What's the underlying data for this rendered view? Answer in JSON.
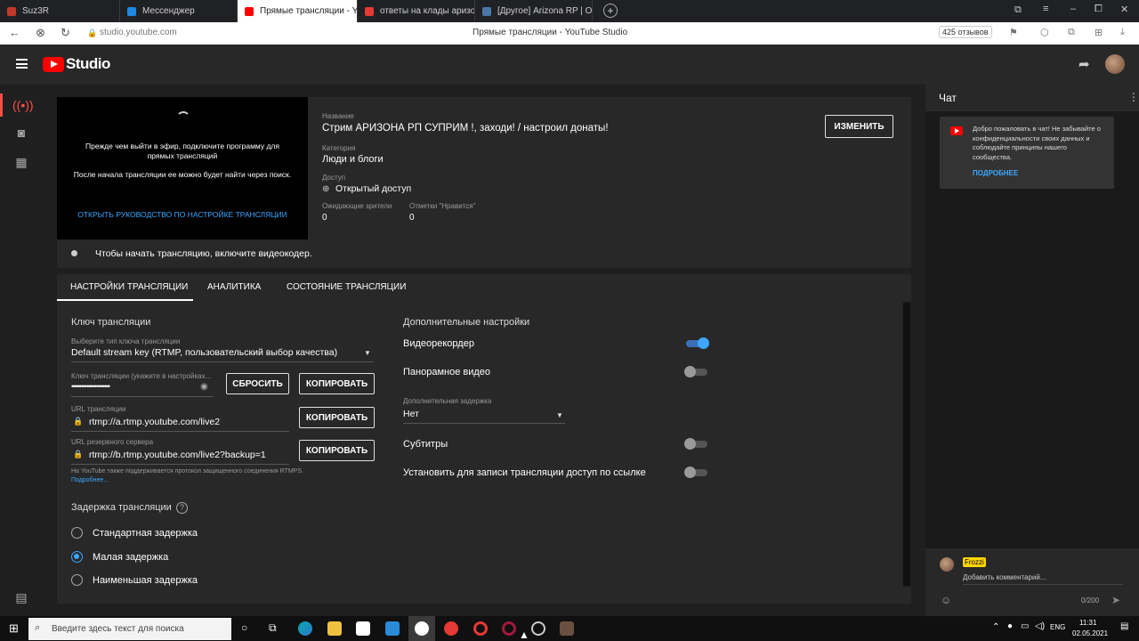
{
  "browser": {
    "tabs": [
      {
        "label": "Suz3R",
        "color": "#c0392b",
        "active": false
      },
      {
        "label": "Мессенджер",
        "color": "#1e88e5",
        "active": false
      },
      {
        "label": "Прямые трансляции - You",
        "color": "#ff0000",
        "active": true
      },
      {
        "label": "ответы на клады аризона",
        "color": "#e53935",
        "active": false
      },
      {
        "label": "[Другое] Arizona RP | Отве",
        "color": "#4a76a8",
        "active": false
      }
    ],
    "new_tab_label": "+",
    "url": "studio.youtube.com",
    "page_title": "Прямые трансляции - YouTube Studio",
    "reviews": "425 отзывов"
  },
  "header": {
    "logo_text": "Studio"
  },
  "preview": {
    "msg1": "Прежде чем выйти в эфир, подключите программу для прямых трансляций",
    "msg2": "После начала трансляции ее можно будет найти через поиск.",
    "guide_link": "ОТКРЫТЬ РУКОВОДСТВО ПО НАСТРОЙКЕ ТРАНСЛЯЦИИ"
  },
  "info": {
    "title_label": "Название",
    "title_value": "Стрим АРИЗОНА РП СУПРИМ !, заходи! / настроил донаты!",
    "category_label": "Категория",
    "category_value": "Люди и блоги",
    "access_label": "Доступ",
    "access_value": "Открытый доступ",
    "waiting_label": "Ожидающие зрители",
    "waiting_value": "0",
    "likes_label": "Отметки \"Нравится\"",
    "likes_value": "0",
    "edit_button": "ИЗМЕНИТЬ"
  },
  "status": {
    "text": "Чтобы начать трансляцию, включите видеокодер."
  },
  "tabs": {
    "settings": "НАСТРОЙКИ ТРАНСЛЯЦИИ",
    "analytics": "АНАЛИТИКА",
    "state": "СОСТОЯНИЕ ТРАНСЛЯЦИИ"
  },
  "stream_key": {
    "heading": "Ключ трансляции",
    "type_label": "Выберите тип ключа трансляции",
    "type_value": "Default stream key (RTMP, пользовательский выбор качества)",
    "key_label": "Ключ трансляции (укажите в настройках...",
    "key_value": "••••••••••••••••••••",
    "reset_button": "СБРОСИТЬ",
    "copy_button": "КОПИРОВАТЬ",
    "url_label": "URL трансляции",
    "url_value": "rtmp://a.rtmp.youtube.com/live2",
    "backup_label": "URL резервного сервера",
    "backup_value": "rtmp://b.rtmp.youtube.com/live2?backup=1",
    "rtmps_note": "На YouTube также поддерживается протокол защищенного соединения RTMPS.",
    "more_link": "Подробнее..."
  },
  "latency": {
    "heading": "Задержка трансляции",
    "help": "?",
    "options": [
      "Стандартная задержка",
      "Малая задержка",
      "Наименьшая задержка"
    ],
    "selected": "Малая задержка"
  },
  "extra": {
    "heading": "Дополнительные настройки",
    "dvr": "Видеорекордер",
    "dvr_on": true,
    "pano": "Панорамное видео",
    "pano_on": false,
    "delay_label": "Дополнительная задержка",
    "delay_value": "Нет",
    "subs": "Субтитры",
    "subs_on": false,
    "unlisted": "Установить для записи трансляции доступ по ссылке",
    "unlisted_on": false
  },
  "chat": {
    "title": "Чат",
    "welcome": "Добро пожаловать в чат! Не забывайте о конфиденциальности своих данных и соблюдайте принципы нашего сообщества.",
    "more": "ПОДРОБНЕЕ",
    "user": "Frozzi",
    "placeholder": "Добавить комментарий...",
    "counter": "0/200"
  },
  "taskbar": {
    "search_placeholder": "Введите здесь текст для поиска",
    "lang": "ENG",
    "time": "11:31",
    "date": "02.05.2021"
  },
  "colors": {
    "accent_blue": "#3ea6ff",
    "link_blue": "#3ea6ff",
    "youtube_red": "#ff0000"
  }
}
